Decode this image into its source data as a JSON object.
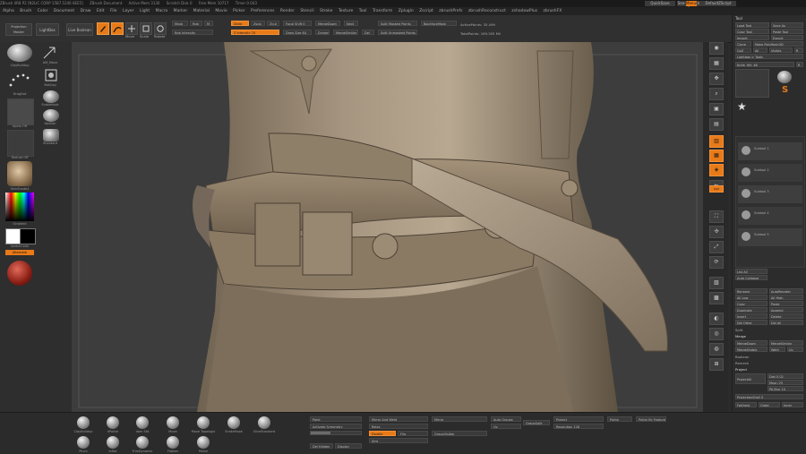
{
  "titlebar": {
    "app": "ZBrush 4R8 P2 [N2LIC CORP 15B7.5240 6EE5]",
    "document": "ZBrush Document",
    "items": [
      "Active Mem 3130",
      "Scratch Disk 0",
      "Free Mem 10717",
      "Timer 0.043"
    ],
    "right_buttons": [
      "QuickSave",
      "See-through 0",
      "Menus",
      "DefaultZScript"
    ]
  },
  "menubar": {
    "items": [
      "Alpha",
      "Brush",
      "Color",
      "Document",
      "Draw",
      "Edit",
      "File",
      "Layer",
      "Light",
      "Macro",
      "Marker",
      "Material",
      "Movie",
      "Picker",
      "Preferences",
      "Render",
      "Stencil",
      "Stroke",
      "Texture",
      "Tool",
      "Transform",
      "Zplugin",
      "Zscript",
      "zbrushPrefs",
      "zbrushReconstruct",
      "zshadowPlus",
      "zbrushFX"
    ]
  },
  "shelf": {
    "projection_master": "Projection Master",
    "lightbox": "LightBox",
    "live_boolean": "Live Boolean",
    "edit": "Edit",
    "draw": "Draw",
    "move": "Move",
    "scale": "Scale",
    "rotate": "Rotate",
    "mrgb": "Mrgb",
    "rgb": "Rgb",
    "m": "M",
    "zadd": "Zadd",
    "zsub": "Zsub",
    "zcut": "Zcut",
    "focal_shift": "Focal Shift 0",
    "rgb_intensity": "Rgb Intensity",
    "z_intensity": "Z Intensity 25",
    "draw_size": "Draw Size 64",
    "dynamic": "Dynamic",
    "active_points": "ActivePoints: 35.499",
    "total_points": "TotalPoints: 169.305 Mil",
    "split_masked": "Split Masked Points",
    "split_unmasked": "Split Unmasked Points",
    "merge_down": "MergeDown",
    "merge_similar": "MergeSimilar",
    "del": "Del",
    "new": "Next",
    "backface_mask": "BackfaceMask"
  },
  "lefttray": {
    "brush_label": "ClayBuildup",
    "stroke_label": "DragDot",
    "alpha_label": "Alpha Off",
    "texture_label": "Texture Off",
    "material_label": "SkinShade4",
    "gradient_label": "Gradient",
    "switch_color": "SwitchColor",
    "alternate": "Alternate",
    "items": [
      "AM_Move",
      "MatCap",
      "Snakehook",
      "Hpolish",
      "Standard"
    ]
  },
  "rightstrip": {
    "buttons": [
      "Bpr",
      "Spix 3",
      "Scroll",
      "Zoom",
      "Actual",
      "AAHalf",
      "Persp",
      "Floor",
      "Local",
      "L.Sym",
      "Frame",
      "Move",
      "Scale",
      "Rotate",
      "Line Fill",
      "PolyF",
      "Transp",
      "Dynamic",
      "Solo",
      "Xpose"
    ]
  },
  "rightpanel": {
    "title": "Tool",
    "load_tool": "Load Tool",
    "save_as": "Save As",
    "copy_tool": "Copy Tool",
    "paste_tool": "Paste Tool",
    "import": "Import",
    "export": "Export",
    "clone": "Clone",
    "make_polymesh": "Make PolyMesh3D",
    "goz": "GoZ",
    "all": "All",
    "visible": "Visible",
    "r": "R",
    "lightbox_tools": "Lightbox > Tools",
    "tool_name": "Knife_Hilt_46",
    "r2": "R",
    "subtools": [
      {
        "name": "Subtool 1"
      },
      {
        "name": "Subtool 2"
      },
      {
        "name": "Subtool 3"
      },
      {
        "name": "Subtool 4"
      },
      {
        "name": "Subtool 5"
      }
    ],
    "list_all": "List All",
    "auto_collapse": "Auto Collapse",
    "rename": "Rename",
    "auto_reorder": "AutoReorder",
    "all_low": "All Low",
    "all_high": "All High",
    "copy": "Copy",
    "paste": "Paste",
    "duplicate": "Duplicate",
    "append": "Append",
    "insert": "Insert",
    "delete": "Delete",
    "del_other": "Del Other",
    "del_all": "Del All",
    "split": "Split",
    "merge": "Merge",
    "merge_down": "MergeDown",
    "merge_similar": "MergeSimilar",
    "merge_visible": "MergeVisible",
    "weld": "Weld",
    "uv": "Uv",
    "boolean": "Boolean",
    "remesh": "Remesh",
    "project": "Project",
    "project_all": "ProjectAll",
    "dist": "Dist 0.02",
    "mean": "Mean 25",
    "pa_blur": "PA Blur 10",
    "projection_shell": "ProjectionShell 0",
    "farthest": "Farthest",
    "outer": "Outer",
    "inner": "Inner"
  },
  "bottombar": {
    "brushes": [
      "ClayBuildup",
      "hPolish",
      "DamStd",
      "Move",
      "Move Topological",
      "SnakeHook",
      "Slide Standard",
      "Pinch",
      "Inflat",
      "TrimDynamic",
      "Flatten",
      "Polish",
      "Pinch"
    ],
    "labels_row1": [
      "ClayBuildup",
      "hPolish",
      "dam Std",
      "Move",
      "Move Topologic",
      "SnakeHook",
      "SliceStandard"
    ],
    "labels_row2": [
      "Pinch",
      "Inflat",
      "TrimDynamic",
      "Flatten",
      "Polish"
    ],
    "paint": {
      "label1": "Paint",
      "activate_symmetry": "Activate Symmetry",
      "mirror_weld": "Mirror And Weld",
      "mirror": "Mirror",
      "auto_groups": "Auto Groups",
      "group_split": "GroupSplit",
      "polish": "Polish",
      "project": "Project",
      "resolution": "Resolution 128",
      "relax": "Relax",
      "smt": "Smt",
      "double": "Double",
      "flip": "Flip",
      "group_visible": "GroupVisible",
      "uv": "Uv",
      "polish_by_feature": "Polish By Features"
    },
    "polycount": "Del Hidden",
    "display": "Display"
  },
  "colors": {
    "accent": "#e87a18",
    "panel": "#2c2c2c",
    "canvas": "#3d3d3d"
  }
}
